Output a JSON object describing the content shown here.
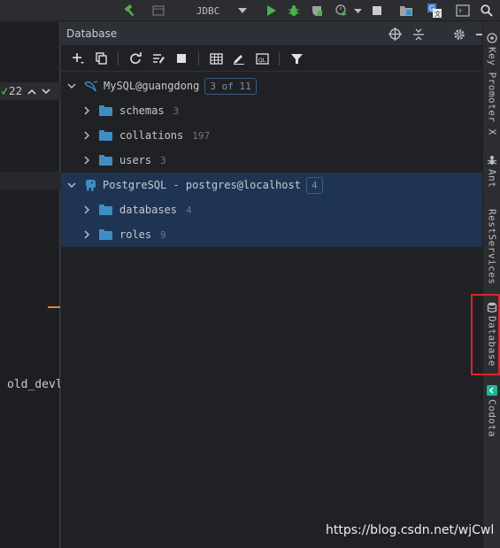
{
  "toolbar": {
    "run_config": "JDBC"
  },
  "editor": {
    "warning_count": "22",
    "code_fragment": "old_devl"
  },
  "panel": {
    "title": "Database"
  },
  "tree": {
    "mysql": {
      "label": "MySQL@guangdong",
      "badge": "3 of 11"
    },
    "mysql_children": [
      {
        "label": "schemas",
        "count": "3"
      },
      {
        "label": "collations",
        "count": "197"
      },
      {
        "label": "users",
        "count": "3"
      }
    ],
    "postgres": {
      "label": "PostgreSQL - postgres@localhost",
      "badge": "4"
    },
    "postgres_children": [
      {
        "label": "databases",
        "count": "4"
      },
      {
        "label": "roles",
        "count": "9"
      }
    ]
  },
  "right_tabs": {
    "key_promoter": "Key Promoter X",
    "ant": "Ant",
    "rest": "RestServices",
    "database": "Database",
    "codota": "Codota"
  },
  "watermark": "https://blog.csdn.net/wjCwl",
  "colors": {
    "selection": "#1f3453",
    "folder": "#3d8fc3",
    "highlight": "#e0222b",
    "run_green": "#4caf50"
  }
}
